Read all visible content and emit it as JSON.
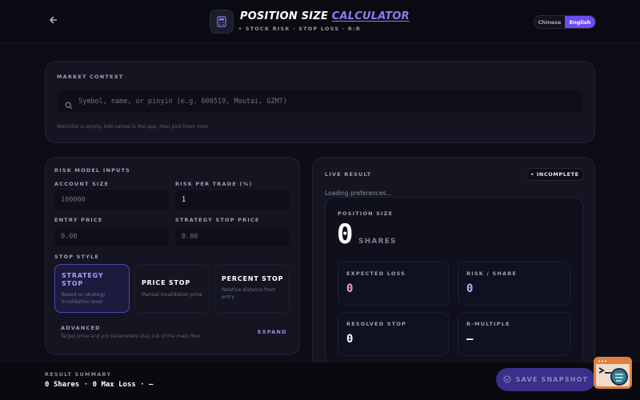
{
  "header": {
    "title_main": "POSITION SIZE ",
    "title_accent": "CALCULATOR",
    "subtitle": "• STOCK RISK · STOP LOSS · R:R",
    "languages": [
      "Chinese",
      "English"
    ],
    "active_language": "English"
  },
  "market": {
    "label": "MARKET CONTEXT",
    "search_placeholder": "Symbol, name, or pinyin (e.g. 600519, Moutai, GZMT)",
    "hint": "Watchlist is empty. Add names in the app, then pick them here."
  },
  "inputs": {
    "label": "RISK MODEL INPUTS",
    "account_size_label": "ACCOUNT SIZE",
    "account_size_placeholder": "100000",
    "risk_label": "RISK PER TRADE (%)",
    "risk_value": "1",
    "entry_label": "ENTRY PRICE",
    "entry_placeholder": "0.00",
    "stop_price_label": "STRATEGY STOP PRICE",
    "stop_price_placeholder": "0.00",
    "stop_style_label": "STOP STYLE",
    "stop_styles": [
      {
        "title_line1": "STRATEGY",
        "title_line2": "STOP",
        "desc_line1": "Based on strategy",
        "desc_line2": "invalidation level"
      },
      {
        "title_line1": "PRICE STOP",
        "title_line2": "",
        "desc_line1": "Manual invalidation price",
        "desc_line2": ""
      },
      {
        "title_line1": "PERCENT STOP",
        "title_line2": "",
        "desc_line1": "Relative distance from",
        "desc_line2": "entry"
      }
    ],
    "advanced_label": "ADVANCED",
    "advanced_desc": "Target price and pro parameters stay out of the main flow",
    "expand_label": "EXPAND"
  },
  "result": {
    "label": "LIVE RESULT",
    "status_badge": "• INCOMPLETE",
    "loading_text": "Loading preferences...",
    "position_size_label": "POSITION SIZE",
    "position_value": "0",
    "position_unit": "SHARES",
    "metrics": [
      {
        "label": "EXPECTED LOSS",
        "value": "0"
      },
      {
        "label": "RISK / SHARE",
        "value": "0"
      },
      {
        "label": "RESOLVED STOP",
        "value": "0"
      },
      {
        "label": "R-MULTIPLE",
        "value": "—"
      }
    ]
  },
  "footer": {
    "summary_label": "RESULT SUMMARY",
    "summary_value": "0 Shares · 0 Max Loss · —",
    "save_label": "SAVE SNAPSHOT"
  },
  "colors": {
    "accent": "#8b7cf6",
    "active_toggle": "#6d4df2",
    "loss_value": "#f2a6b6",
    "risk_value": "#b8b0ff",
    "float_widget": "#e27e3e"
  },
  "icons": [
    "back-arrow-icon",
    "calculator-icon",
    "search-icon",
    "check-circle-icon",
    "terminal-search-icon"
  ]
}
